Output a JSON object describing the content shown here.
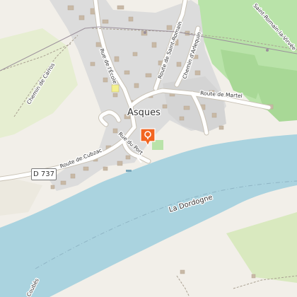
{
  "map": {
    "town_label": "Asques",
    "river_label": "La Dordogne",
    "route_badge": "D 737",
    "street_labels": {
      "rue_ecole": "Rue de l'École",
      "route_saint_romain": "Route de Saint-Romain",
      "chemin_arlequin": "Chemin d'Arlequin",
      "route_martel": "Route de Martel",
      "chemin_carros": "Chemin de Carros",
      "route_cubzac": "Route de Cubzac",
      "rue_du_port": "Rue du Port",
      "saint_romain_vinvee": "Saint-Romain-la-Virvée",
      "coubes": "Coubès"
    },
    "marker": {
      "icon": "location-pin-icon",
      "color": "#f26522"
    },
    "colors": {
      "land": "#f2efe9",
      "water": "#aad3df",
      "town": "#dcdcdc",
      "vineyard": "#b9e3a9",
      "meadow": "#e6eed1",
      "road": "#ffffff"
    }
  }
}
